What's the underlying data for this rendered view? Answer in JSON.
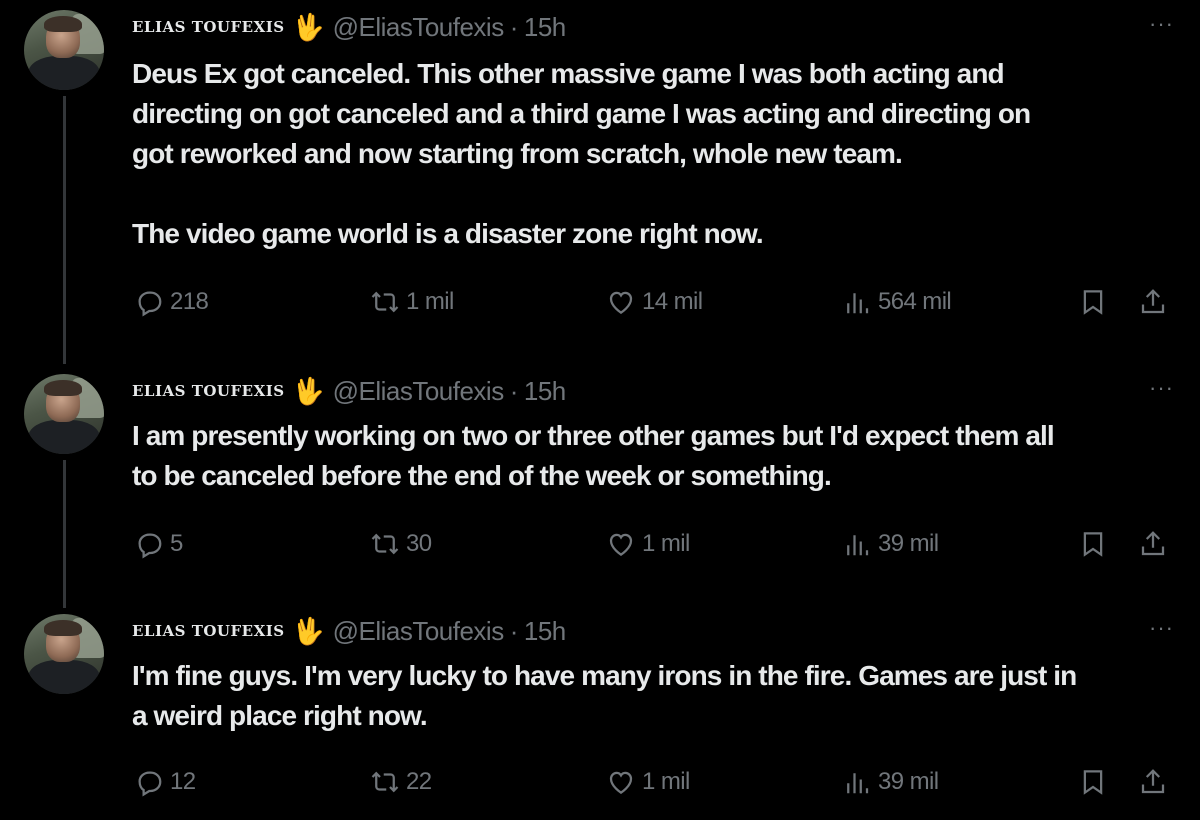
{
  "tweets": [
    {
      "name": "ELIAS TOUFEXIS",
      "emoji": "🖖",
      "handle": "@EliasToufexis",
      "dot": "·",
      "time": "15h",
      "more": "···",
      "text": "Deus Ex got canceled. This other massive game I was both acting and\ndirecting on got canceled and a third game I was acting and directing on\ngot reworked and now starting from scratch, whole new team.\n\nThe video game world is a disaster zone right now.",
      "replies": "218",
      "reposts": "1 mil",
      "likes": "14 mil",
      "views": "564 mil"
    },
    {
      "name": "ELIAS TOUFEXIS",
      "emoji": "🖖",
      "handle": "@EliasToufexis",
      "dot": "·",
      "time": "15h",
      "more": "···",
      "text": "I am presently working on two or three other games but I'd expect them all\nto be canceled before the end of the week or something.",
      "replies": "5",
      "reposts": "30",
      "likes": "1 mil",
      "views": "39 mil"
    },
    {
      "name": "ELIAS TOUFEXIS",
      "emoji": "🖖",
      "handle": "@EliasToufexis",
      "dot": "·",
      "time": "15h",
      "more": "···",
      "text": "I'm fine guys. I'm very lucky to have many irons in the fire. Games are just in\na weird place right now.",
      "replies": "12",
      "reposts": "22",
      "likes": "1 mil",
      "views": "39 mil"
    }
  ],
  "icons": {
    "reply": "reply-icon",
    "repost": "repost-icon",
    "like": "like-icon",
    "views": "views-icon",
    "bookmark": "bookmark-icon",
    "share": "share-icon",
    "more": "more-icon"
  },
  "colors": {
    "background": "#000000",
    "text": "#e7e9ea",
    "muted": "#71767b",
    "thread_line": "#333639",
    "emoji": "#f4b93a"
  }
}
